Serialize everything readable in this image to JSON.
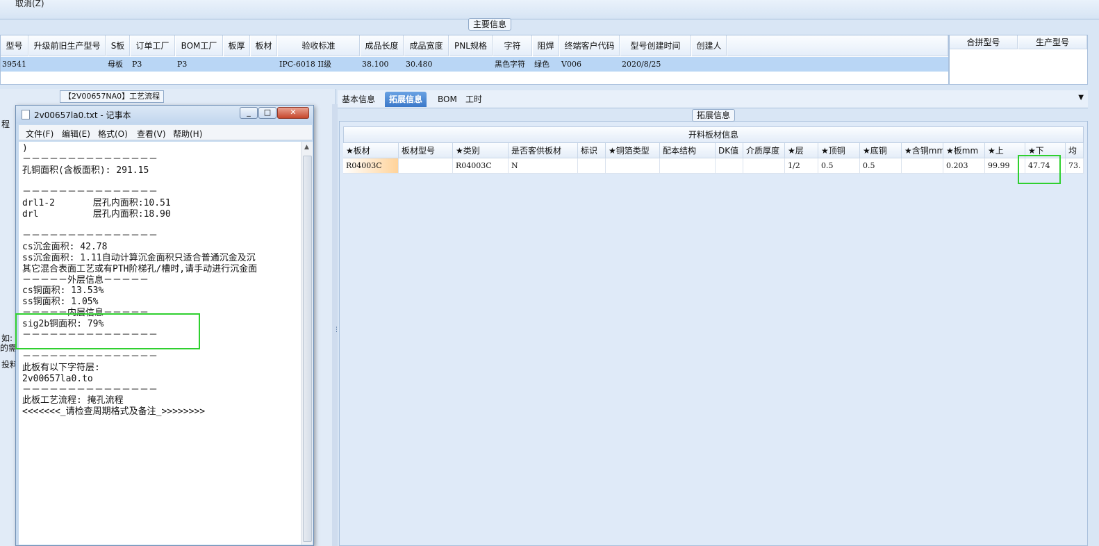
{
  "topbar": {
    "cancel_label": "取消(Z)"
  },
  "main_info": {
    "title": "主要信息",
    "columns": [
      "型号",
      "升级前旧生产型号",
      "S板",
      "订单工厂",
      "BOM工厂",
      "板厚",
      "板材",
      "验收标准",
      "成品长度",
      "成品宽度",
      "PNL规格",
      "字符",
      "阻焊",
      "终端客户代码",
      "型号创建时间",
      "创建人"
    ],
    "row": [
      "39541",
      "",
      "母板",
      "P3",
      "P3",
      "",
      "",
      "IPC-6018 II级",
      "38.100",
      "30.480",
      "",
      "黑色字符",
      "绿色",
      "V006",
      "2020/8/25",
      ""
    ]
  },
  "side_table": {
    "columns": [
      "合拼型号",
      "生产型号"
    ]
  },
  "left_panel": {
    "flow_title": "【2V00657NA0】工艺流程",
    "partial_left_a": "程",
    "partial_left_b": "如:",
    "partial_left_c": "的需",
    "partial_left_d": "投料"
  },
  "notepad": {
    "title": "2v00657la0.txt - 记事本",
    "buttons": {
      "minimize": "_",
      "maximize": "□",
      "close": "✕"
    },
    "menus": [
      "文件(F)",
      "编辑(E)",
      "格式(O)",
      "查看(V)",
      "帮助(H)"
    ],
    "lines": [
      ")",
      "－－－－－－－－－－－－－－－",
      "孔铜面积(含板面积): 291.15",
      "",
      "－－－－－－－－－－－－－－－",
      "drl1-2       层孔内面积:10.51",
      "drl          层孔内面积:18.90",
      "",
      "－－－－－－－－－－－－－－－",
      "cs沉金面积: 42.78",
      "ss沉金面积: 1.11自动计算沉金面积只适合普通沉金及沉",
      "其它混合表面工艺或有PTH阶梯孔/槽时,请手动进行沉金面",
      "－－－－－外层信息－－－－－",
      "cs铜面积: 13.53%",
      "ss铜面积: 1.05%",
      "－－－－－内层信息－－－－－",
      "sig2b铜面积: 79%",
      "－－－－－－－－－－－－－－－",
      "",
      "－－－－－－－－－－－－－－－",
      "此板有以下字符层:",
      "2v00657la0.to",
      "－－－－－－－－－－－－－－－",
      "此板工艺流程: 掩孔流程",
      "<<<<<<<_请检查周期格式及备注_>>>>>>>>"
    ]
  },
  "tabs": [
    "基本信息",
    "拓展信息",
    "BOM",
    "工时"
  ],
  "ext_info": {
    "title": "拓展信息",
    "grid_caption": "开料板材信息",
    "columns": [
      "★板材",
      "板材型号",
      "★类别",
      "是否客供板材",
      "标识",
      "★铜箔类型",
      "配本结构",
      "DK值",
      "介质厚度",
      "★层",
      "★顶铜",
      "★底铜",
      "★含铜mm",
      "★板mm",
      "★上",
      "★下",
      "均"
    ],
    "row": [
      "R04003C",
      "",
      "R04003C",
      "N",
      "",
      "",
      "",
      "",
      "",
      "1/2",
      "0.5",
      "0.5",
      "",
      "0.203",
      "99.99",
      "47.74",
      "73."
    ]
  }
}
